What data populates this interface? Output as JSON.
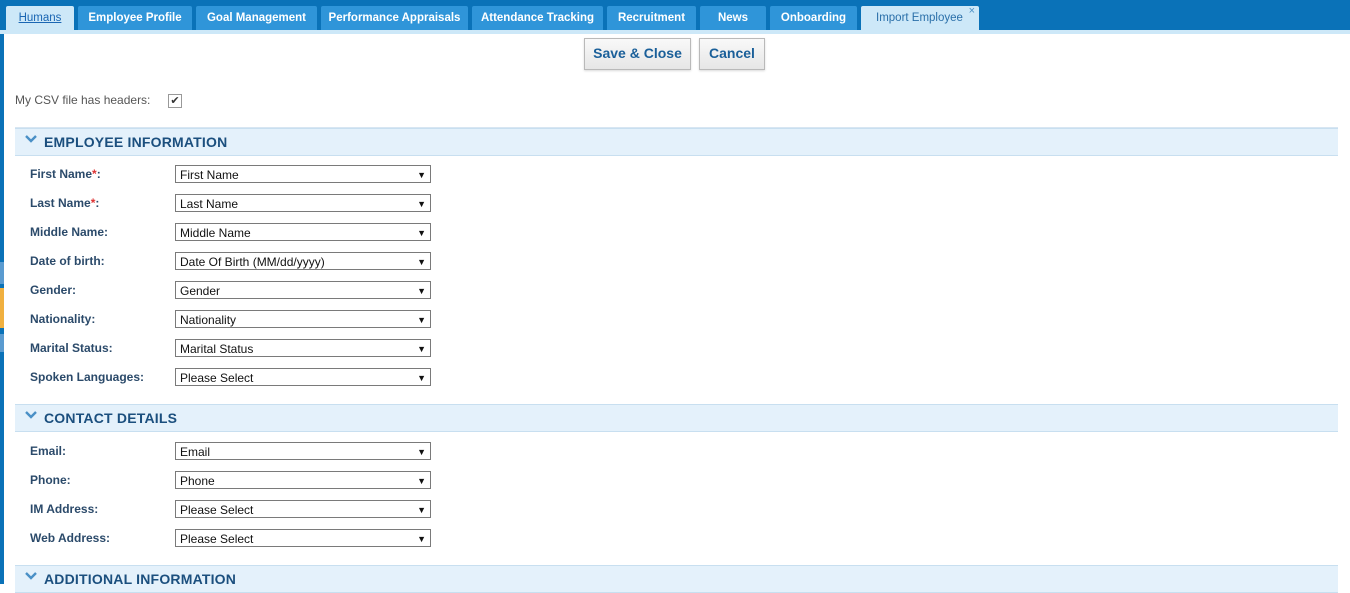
{
  "tabs": [
    {
      "label": "Humans"
    },
    {
      "label": "Employee Profile"
    },
    {
      "label": "Goal Management"
    },
    {
      "label": "Performance Appraisals"
    },
    {
      "label": "Attendance Tracking"
    },
    {
      "label": "Recruitment"
    },
    {
      "label": "News"
    },
    {
      "label": "Onboarding"
    },
    {
      "label": "Import Employee",
      "close": "×"
    }
  ],
  "toolbar": {
    "save_close": "Save & Close",
    "cancel": "Cancel"
  },
  "options": {
    "csv_headers_label": "My CSV file has headers:",
    "csv_headers_checked": true,
    "check_mark": "✔"
  },
  "sections": {
    "employee": {
      "title": "EMPLOYEE INFORMATION",
      "fields": [
        {
          "label": "First Name",
          "required": "*",
          "colon": ":",
          "value": "First Name"
        },
        {
          "label": "Last Name",
          "required": "*",
          "colon": ":",
          "value": "Last Name"
        },
        {
          "label": "Middle Name:",
          "value": "Middle Name"
        },
        {
          "label": "Date of birth:",
          "value": "Date Of Birth (MM/dd/yyyy)"
        },
        {
          "label": "Gender:",
          "value": "Gender"
        },
        {
          "label": "Nationality:",
          "value": "Nationality"
        },
        {
          "label": "Marital Status:",
          "value": "Marital Status"
        },
        {
          "label": "Spoken Languages:",
          "value": "Please Select"
        }
      ]
    },
    "contact": {
      "title": "CONTACT DETAILS",
      "fields": [
        {
          "label": "Email:",
          "value": "Email"
        },
        {
          "label": "Phone:",
          "value": "Phone"
        },
        {
          "label": "IM Address:",
          "value": "Please Select"
        },
        {
          "label": "Web Address:",
          "value": "Please Select"
        }
      ]
    },
    "additional": {
      "title": "ADDITIONAL INFORMATION"
    }
  },
  "dropdown_arrow": "▼",
  "colors": {
    "tabbar": "#0a72b8",
    "tab": "#2f95d9",
    "active_tab": "#cde8f8",
    "section_bg": "#e4f1fb",
    "label": "#2b4a6a",
    "required": "#d33"
  }
}
